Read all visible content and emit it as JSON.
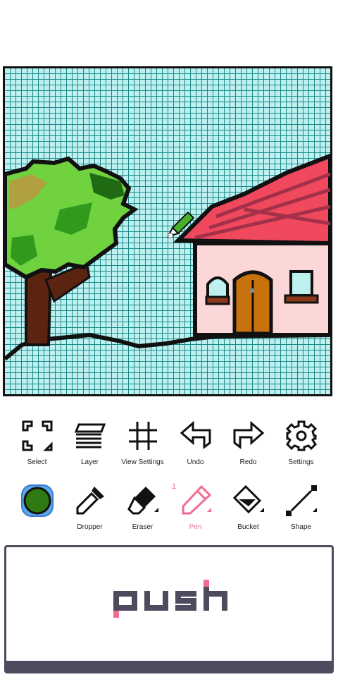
{
  "canvas": {
    "grid": true,
    "tool_cursor": "pen"
  },
  "tools_row_1": [
    {
      "id": "select",
      "label": "Select",
      "icon": "select-icon"
    },
    {
      "id": "layer",
      "label": "Layer",
      "icon": "layer-icon"
    },
    {
      "id": "view_settings",
      "label": "View Settings",
      "icon": "grid-icon"
    },
    {
      "id": "undo",
      "label": "Undo",
      "icon": "undo-icon"
    },
    {
      "id": "redo",
      "label": "Redo",
      "icon": "redo-icon"
    },
    {
      "id": "settings",
      "label": "Settings",
      "icon": "gear-icon"
    }
  ],
  "tools_row_2": [
    {
      "id": "color",
      "label": "",
      "icon": "color-swatch",
      "color": "#2f7a12"
    },
    {
      "id": "dropper",
      "label": "Dropper",
      "icon": "dropper-icon"
    },
    {
      "id": "eraser",
      "label": "Eraser",
      "icon": "eraser-icon"
    },
    {
      "id": "pen",
      "label": "Pen",
      "icon": "pen-icon",
      "active": true,
      "badge": "1"
    },
    {
      "id": "bucket",
      "label": "Bucket",
      "icon": "bucket-icon"
    },
    {
      "id": "shape",
      "label": "Shape",
      "icon": "shape-icon"
    }
  ],
  "push_button": {
    "label": "push"
  },
  "colors": {
    "accent": "#f26c92",
    "canvas_bg": "#bdf0ef",
    "panel_border": "#4f4a5e"
  }
}
